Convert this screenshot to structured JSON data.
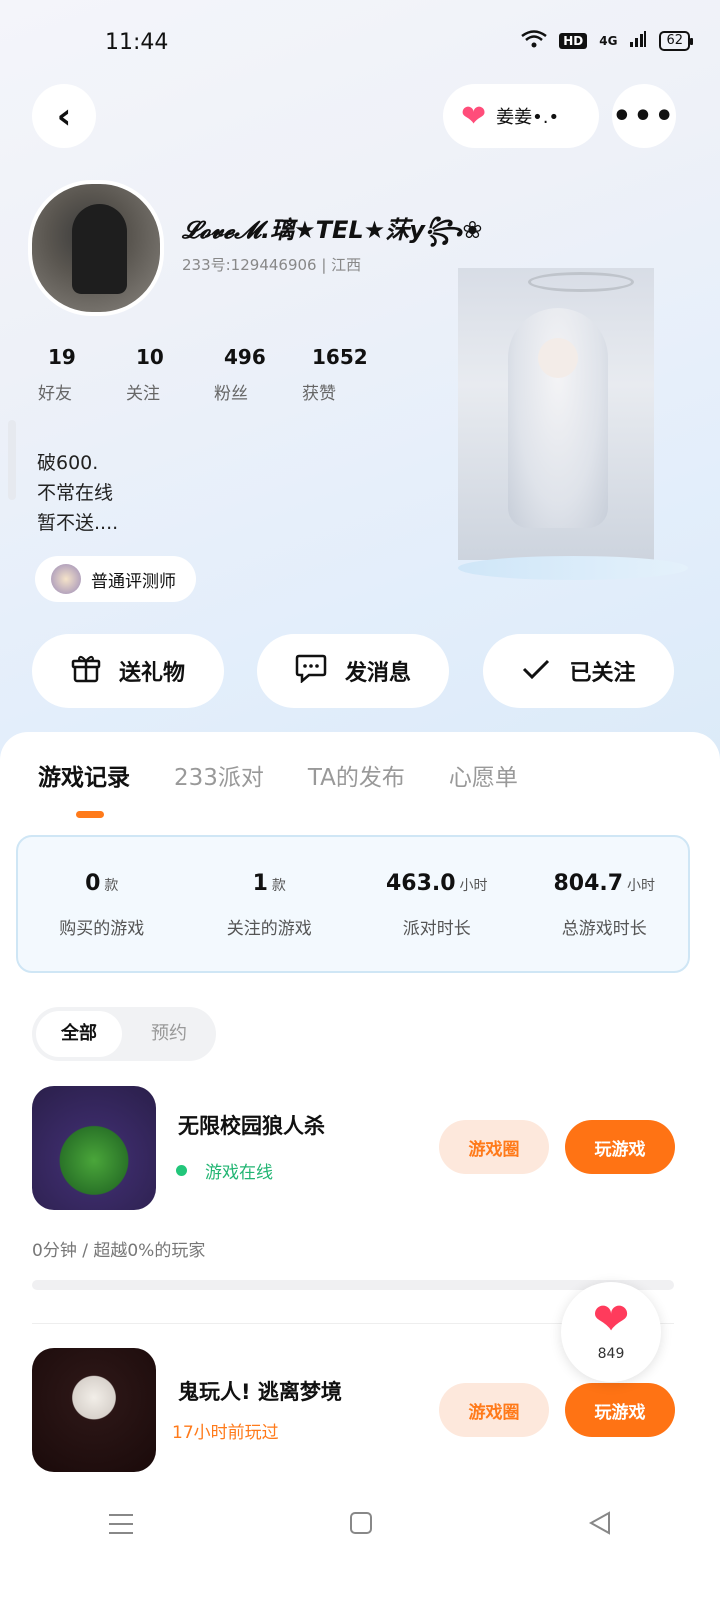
{
  "status_bar": {
    "time": "11:44",
    "hd": "HD",
    "network": "4G",
    "battery": "62"
  },
  "header": {
    "friend_name": "姜姜•.•"
  },
  "profile": {
    "username": "𝓛𝓸𝓿𝓮𝓜.璃★TEL★莯y꧂❀",
    "uid_region": "233号:129446906 | 江西",
    "stats": [
      {
        "num": "19",
        "label": "好友"
      },
      {
        "num": "10",
        "label": "关注"
      },
      {
        "num": "496",
        "label": "粉丝"
      },
      {
        "num": "1652",
        "label": "获赞"
      }
    ],
    "bio": [
      "破600.",
      "不常在线",
      "暂不送...."
    ],
    "tag": "普通评测师"
  },
  "actions": {
    "gift": "送礼物",
    "message": "发消息",
    "follow": "已关注"
  },
  "tabs": [
    "游戏记录",
    "233派对",
    "TA的发布",
    "心愿单"
  ],
  "summary": [
    {
      "num": "0",
      "unit": "款",
      "label": "购买的游戏"
    },
    {
      "num": "1",
      "unit": "款",
      "label": "关注的游戏"
    },
    {
      "num": "463.0",
      "unit": "小时",
      "label": "派对时长"
    },
    {
      "num": "804.7",
      "unit": "小时",
      "label": "总游戏时长"
    }
  ],
  "segment": {
    "all": "全部",
    "preorder": "预约"
  },
  "games": [
    {
      "title": "无限校园狼人杀",
      "status": "游戏在线",
      "circle": "游戏圈",
      "play": "玩游戏",
      "playtime": "0分钟 / 超越0%的玩家",
      "progress_percent": 0
    },
    {
      "title": "鬼玩人! 逃离梦境",
      "recent": "17小时前玩过",
      "circle": "游戏圈",
      "play": "玩游戏"
    }
  ],
  "like_fab": {
    "count": "849"
  },
  "colors": {
    "accent": "#ff7a1a",
    "online": "#22c67a",
    "heart": "#ff3b5c"
  }
}
